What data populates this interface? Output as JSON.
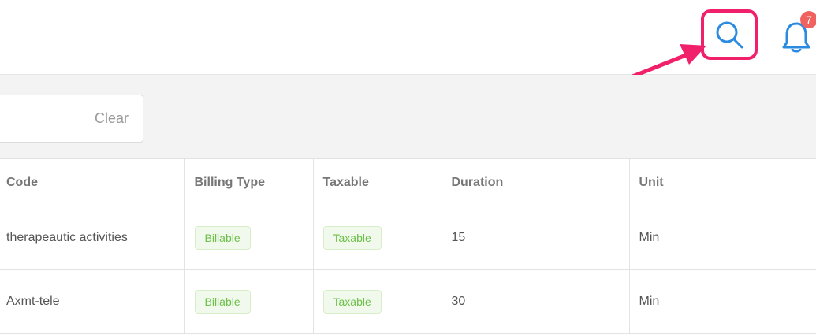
{
  "header": {
    "search_icon": "search-icon",
    "bell_icon": "bell-icon",
    "notification_count": "7",
    "accent_color": "#f0206a"
  },
  "filter": {
    "search_value": "",
    "clear_label": "Clear"
  },
  "table": {
    "columns": [
      "Code",
      "Billing Type",
      "Taxable",
      "Duration",
      "Unit"
    ],
    "rows": [
      {
        "code": "therapeautic activities",
        "billing_type": "Billable",
        "taxable": "Taxable",
        "duration": "15",
        "unit": "Min"
      },
      {
        "code": "Axmt-tele",
        "billing_type": "Billable",
        "taxable": "Taxable",
        "duration": "30",
        "unit": "Min"
      }
    ]
  }
}
